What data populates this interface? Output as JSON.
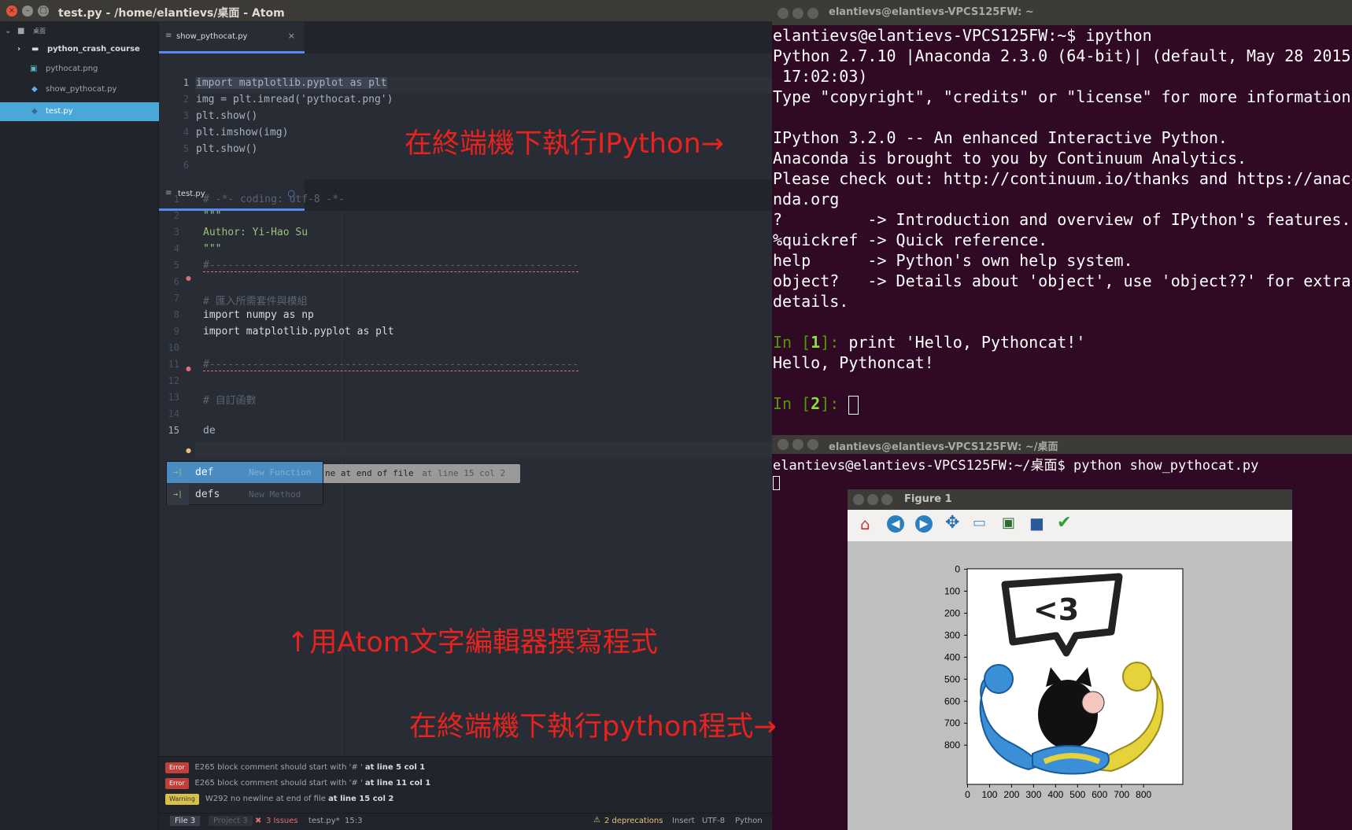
{
  "atom": {
    "title": "test.py - /home/elantievs/桌面 - Atom",
    "tree": {
      "root_label": "桌面",
      "items": [
        {
          "label": "python_crash_course",
          "type": "folder"
        },
        {
          "label": "pythocat.png",
          "type": "image"
        },
        {
          "label": "show_pythocat.py",
          "type": "python"
        },
        {
          "label": "test.py",
          "type": "python",
          "selected": true
        }
      ]
    },
    "pane1": {
      "tab": "show_pythocat.py",
      "tab_close": "×",
      "lines": [
        "import matplotlib.pyplot as plt",
        "img = plt.imread('pythocat.png')",
        "plt.show()",
        "plt.imshow(img)",
        "plt.show()",
        ""
      ],
      "line_numbers": [
        "1",
        "2",
        "3",
        "4",
        "5",
        "6"
      ]
    },
    "pane2": {
      "tab": "test.py",
      "tab_modified": "○",
      "line_numbers": [
        "1",
        "2",
        "3",
        "4",
        "5",
        "6",
        "7",
        "8",
        "9",
        "10",
        "11",
        "12",
        "13",
        "14",
        "15"
      ],
      "lines": [
        "# -*- coding: utf-8 -*-",
        "\"\"\"",
        "Author: Yi-Hao Su",
        "\"\"\"",
        "#------------------------------------------------------------",
        "",
        "# 匯入所需套件與模組",
        "import numpy as np",
        "import matplotlib.pyplot as plt",
        "",
        "#------------------------------------------------------------",
        "",
        "# 自訂函數",
        "",
        "de"
      ]
    },
    "autocomplete": {
      "items": [
        {
          "prefix": "de",
          "rest": "f",
          "desc": "New Function"
        },
        {
          "prefix": "de",
          "rest": "fs",
          "desc": "New Method"
        }
      ],
      "icon": "→|"
    },
    "lint_tooltip": "ne at end of file",
    "lint_tooltip_loc": "at line 15 col 2",
    "lint": [
      {
        "badge": "Error",
        "msg": "E265 block comment should start with '# '",
        "loc": "at line 5 col 1"
      },
      {
        "badge": "Error",
        "msg": "E265 block comment should start with '# '",
        "loc": "at line 11 col 1"
      },
      {
        "badge": "Warning",
        "msg": "W292 no newline at end of file",
        "loc": "at line 15 col 2"
      }
    ],
    "status": {
      "file_tab": "File 3",
      "project_tab": "Project 3",
      "issues": "3 Issues",
      "filename": "test.py*",
      "cursor": "15:3",
      "deprecations": "2 deprecations",
      "mode": "Insert",
      "encoding": "UTF-8",
      "grammar": "Python"
    }
  },
  "annotations": {
    "ipython": "在終端機下執行IPython→",
    "atom": "↑用Atom文字編輯器撰寫程式",
    "python": "在終端機下執行python程式→"
  },
  "term1": {
    "title": "elantievs@elantievs-VPCS125FW: ~",
    "lines": [
      "elantievs@elantievs-VPCS125FW:~$ ipython",
      "Python 2.7.10 |Anaconda 2.3.0 (64-bit)| (default, May 28 2015,",
      " 17:02:03)",
      "Type \"copyright\", \"credits\" or \"license\" for more information.",
      "",
      "IPython 3.2.0 -- An enhanced Interactive Python.",
      "Anaconda is brought to you by Continuum Analytics.",
      "Please check out: http://continuum.io/thanks and https://anaco",
      "nda.org",
      "?         -> Introduction and overview of IPython's features.",
      "%quickref -> Quick reference.",
      "help      -> Python's own help system.",
      "object?   -> Details about 'object', use 'object??' for extra",
      "details."
    ],
    "in1_prompt_a": "In [",
    "in1_num": "1",
    "in1_prompt_b": "]: ",
    "in1_cmd": "print 'Hello, Pythoncat!'",
    "out1": "Hello, Pythoncat!",
    "in2_num": "2"
  },
  "term2": {
    "title": "elantievs@elantievs-VPCS125FW: ~/桌面",
    "line": "elantievs@elantievs-VPCS125FW:~/桌面$ python show_pythocat.py"
  },
  "figure": {
    "title": "Figure 1",
    "toolbar": [
      "home-icon",
      "back-icon",
      "forward-icon",
      "pan-icon",
      "zoom-icon",
      "subplots-icon",
      "save-icon",
      "check-icon"
    ],
    "image_text": "<3",
    "x_ticks": [
      "0",
      "100",
      "200",
      "300",
      "400",
      "500",
      "600",
      "700",
      "800"
    ],
    "y_ticks": [
      "0",
      "100",
      "200",
      "300",
      "400",
      "500",
      "600",
      "700",
      "800"
    ]
  }
}
